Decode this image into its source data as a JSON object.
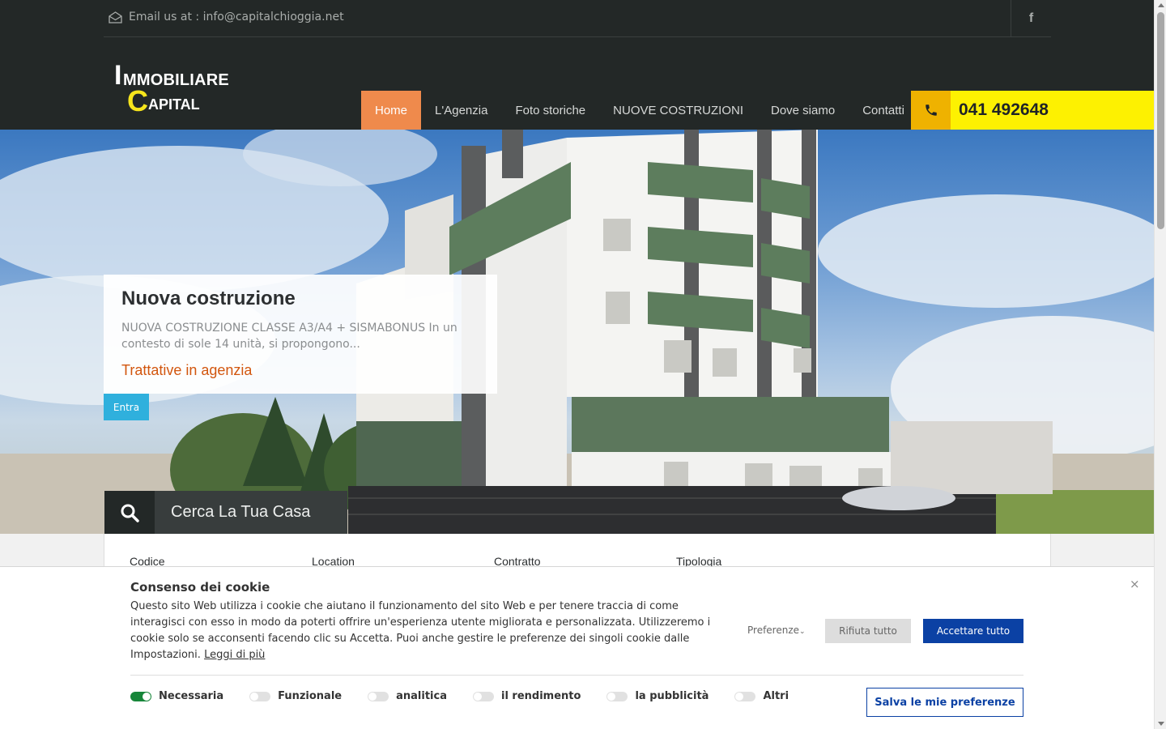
{
  "topbar": {
    "email_text": "Email us at : info@capitalchioggia.net",
    "email_icon": "envelope-icon",
    "facebook_icon": "facebook-icon",
    "facebook_glyph": "f"
  },
  "logo": {
    "i": "I",
    "rest1": "MMOBILIARE",
    "c": "C",
    "rest2": "APITAL"
  },
  "nav": {
    "items": [
      {
        "label": "Home",
        "active": true
      },
      {
        "label": "L'Agenzia"
      },
      {
        "label": "Foto storiche"
      },
      {
        "label": "NUOVE COSTRUZIONI"
      },
      {
        "label": "Dove siamo"
      },
      {
        "label": "Contatti"
      }
    ]
  },
  "phone": {
    "icon": "phone-icon",
    "number": "041 492648"
  },
  "hero": {
    "title": "Nuova costruzione",
    "description": "NUOVA COSTRUZIONE CLASSE A3/A4 + SISMABONUS In un contesto di sole 14 unità, si propongono...",
    "price": "Trattative in agenzia",
    "enter_label": "Entra"
  },
  "search": {
    "title": "Cerca La Tua Casa",
    "icon": "search-icon",
    "labels": [
      "Codice",
      "Location",
      "Contratto",
      "Tipologia"
    ]
  },
  "cookie": {
    "title": "Consenso dei cookie",
    "text": "Questo sito Web utilizza i cookie che aiutano il funzionamento del sito Web e per tenere traccia di come interagisci con esso in modo da poterti offrire un'esperienza utente migliorata e personalizzata. Utilizzeremo i cookie solo se acconsenti facendo clic su Accetta. Puoi anche gestire le preferenze dei singoli cookie dalle Impostazioni.",
    "link": "Leggi di più",
    "close": "×",
    "preferences": "Preferenze",
    "reject": "Rifiuta tutto",
    "accept": "Accettare tutto",
    "toggles": [
      {
        "label": "Necessaria",
        "on": true
      },
      {
        "label": "Funzionale",
        "on": false
      },
      {
        "label": "analitica",
        "on": false
      },
      {
        "label": "il rendimento",
        "on": false
      },
      {
        "label": "la pubblicità",
        "on": false
      },
      {
        "label": "Altri",
        "on": false
      }
    ],
    "save": "Salva le mie preferenze"
  },
  "colors": {
    "topbar_bg": "#232827",
    "nav_active": "#ef8a4c",
    "phone_bg": "#fdf101",
    "phone_icon_bg": "#efb200",
    "entra_bg": "#2fb0dd",
    "price": "#d2560e",
    "accept_bg": "#0b41a4",
    "toggle_on": "#17863a"
  }
}
